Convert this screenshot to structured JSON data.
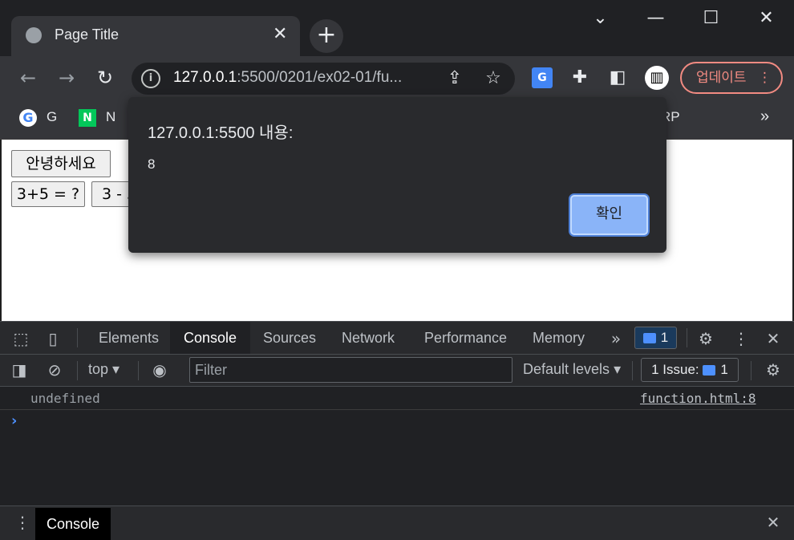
{
  "browser": {
    "tab_title": "Page Title",
    "tab_close": "✕",
    "new_tab": "+",
    "window_controls": {
      "chevron": "⌄",
      "minimize": "—",
      "maximize": "☐",
      "close": "✕"
    },
    "nav": {
      "back": "←",
      "forward": "→",
      "reload": "↻"
    },
    "url_host": "127.0.0.1",
    "url_rest": ":5500/0201/ex02-01/fu...",
    "update_label": "업데이트",
    "bookmarks": [
      {
        "label": "G"
      },
      {
        "label": "N"
      },
      {
        "label": "RP"
      }
    ],
    "bookmarks_more": "»"
  },
  "page": {
    "hello_button": "안녕하세요",
    "add_button": "3+5 = ?",
    "sub_button": "3 - 5"
  },
  "dialog": {
    "title": "127.0.0.1:5500 내용:",
    "message": "8",
    "ok_label": "확인"
  },
  "devtools": {
    "tabs": [
      "Elements",
      "Console",
      "Sources",
      "Network",
      "Performance",
      "Memory"
    ],
    "active_tab": "Console",
    "more_tabs": "»",
    "issues_badge": "1",
    "context": "top",
    "filter_placeholder": "Filter",
    "levels": "Default levels",
    "issues_label": "1 Issue:",
    "issues_count": "1",
    "log": {
      "text": "undefined",
      "source": "function.html:8"
    },
    "prompt": "›",
    "drawer_tab": "Console",
    "close": "✕"
  },
  "colors": {
    "accent": "#8ab4f8",
    "update": "#f28b82",
    "page_bg": "#ffffff"
  }
}
